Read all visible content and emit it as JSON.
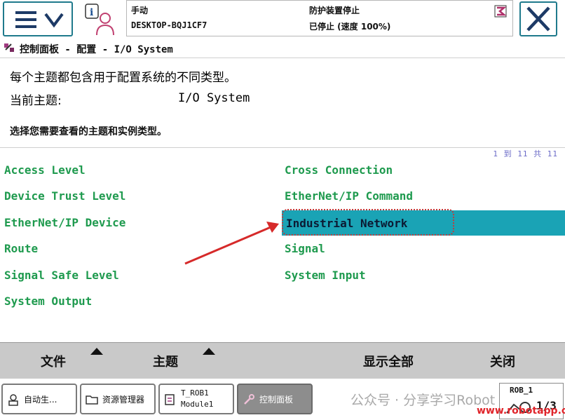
{
  "status": {
    "mode": "手动",
    "system": "DESKTOP-BQJ1CF7",
    "safety": "防护装置停止",
    "speed": "已停止 (速度 100%)"
  },
  "breadcrumb": "控制面板 - 配置 - I/O System",
  "description": "每个主题都包含用于配置系统的不同类型。",
  "current_topic_label": "当前主题:",
  "current_topic_value": "I/O System",
  "select_hint": "选择您需要查看的主题和实例类型。",
  "counter": "1 到 11 共 11",
  "types_left": [
    "Access Level",
    "Device Trust Level",
    "EtherNet/IP Device",
    "Route",
    "Signal Safe Level",
    "System Output"
  ],
  "types_right": [
    "Cross Connection",
    "EtherNet/IP Command",
    "Industrial Network",
    "Signal",
    "System Input"
  ],
  "selected_type": "Industrial Network",
  "commands": {
    "file": "文件",
    "topic": "主题",
    "show_all": "显示全部",
    "close": "关闭"
  },
  "taskbar": {
    "auto": "自动生...",
    "explorer": "资源管理器",
    "rob_line1": "T_ROB1",
    "rob_line2": "Module1",
    "control_panel": "控制面板",
    "rob_status": "ROB_1",
    "rob_fraction": "1/3"
  },
  "watermark": "公众号 · 分享学习Robot",
  "watermark_url": "www.robotapp.cn",
  "colors": {
    "accent": "#1aa3b5",
    "item_text": "#1e9a4e",
    "arrow": "#d62a2a"
  }
}
